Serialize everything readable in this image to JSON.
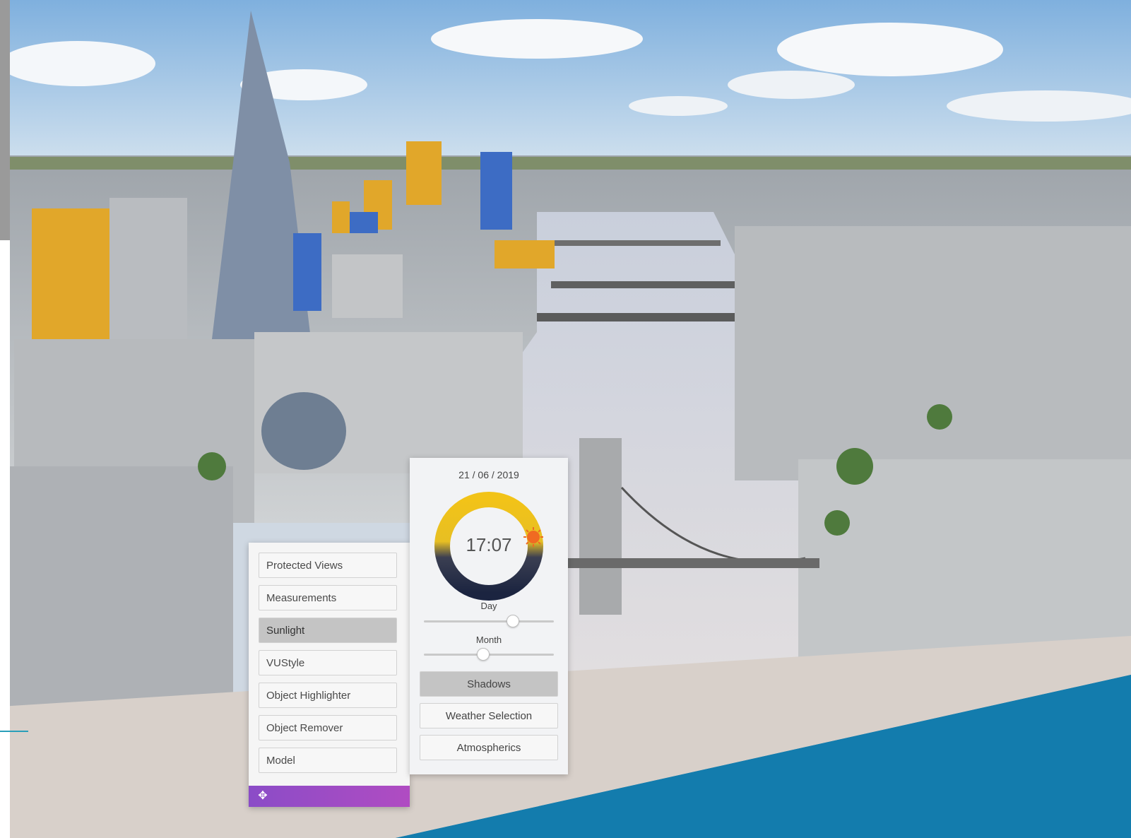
{
  "colors": {
    "accent_band": "#137cad",
    "menu_footer": "#9b4cc5",
    "sun_arc_warm": "#f2c318",
    "sun_arc_night": "#1b2440"
  },
  "menu": {
    "items": [
      {
        "label": "Protected Views",
        "active": false
      },
      {
        "label": "Measurements",
        "active": false
      },
      {
        "label": "Sunlight",
        "active": true
      },
      {
        "label": "VUStyle",
        "active": false
      },
      {
        "label": "Object Highlighter",
        "active": false
      },
      {
        "label": "Object Remover",
        "active": false
      },
      {
        "label": "Model",
        "active": false
      }
    ],
    "footer_icon": "move-icon"
  },
  "sunlight": {
    "date": "21 / 06 / 2019",
    "time": "17:07",
    "sun_icon": "sun-icon",
    "day_label": "Day",
    "day_value_fraction": 0.68,
    "month_label": "Month",
    "month_value_fraction": 0.45,
    "buttons": {
      "shadows": "Shadows",
      "weather": "Weather Selection",
      "atmospherics": "Atmospherics"
    }
  }
}
